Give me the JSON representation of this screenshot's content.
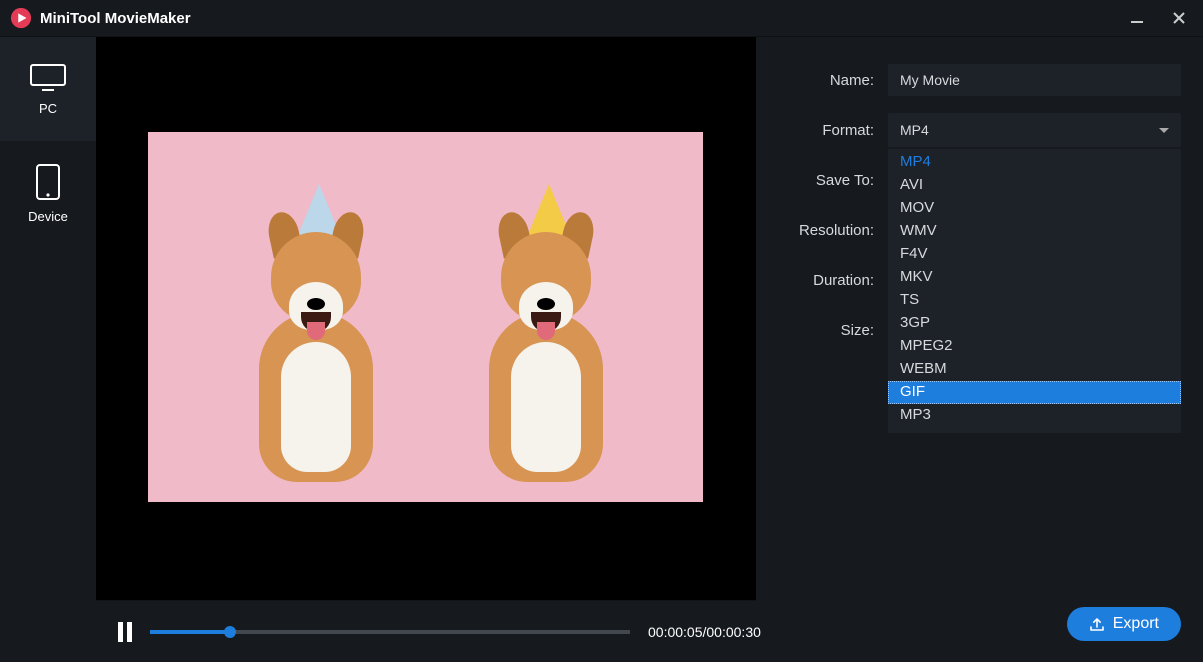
{
  "title": "MiniTool MovieMaker",
  "sidebar": {
    "items": [
      {
        "label": "PC"
      },
      {
        "label": "Device"
      }
    ]
  },
  "transport": {
    "current": "00:00:05",
    "total": "00:00:30"
  },
  "panel": {
    "name_label": "Name:",
    "name_value": "My Movie",
    "format_label": "Format:",
    "format_value": "MP4",
    "saveto_label": "Save To:",
    "resolution_label": "Resolution:",
    "duration_label": "Duration:",
    "size_label": "Size:"
  },
  "format_options": [
    "MP4",
    "AVI",
    "MOV",
    "WMV",
    "F4V",
    "MKV",
    "TS",
    "3GP",
    "MPEG2",
    "WEBM",
    "GIF",
    "MP3"
  ],
  "format_selected": "MP4",
  "format_highlight": "GIF",
  "export_label": "Export"
}
